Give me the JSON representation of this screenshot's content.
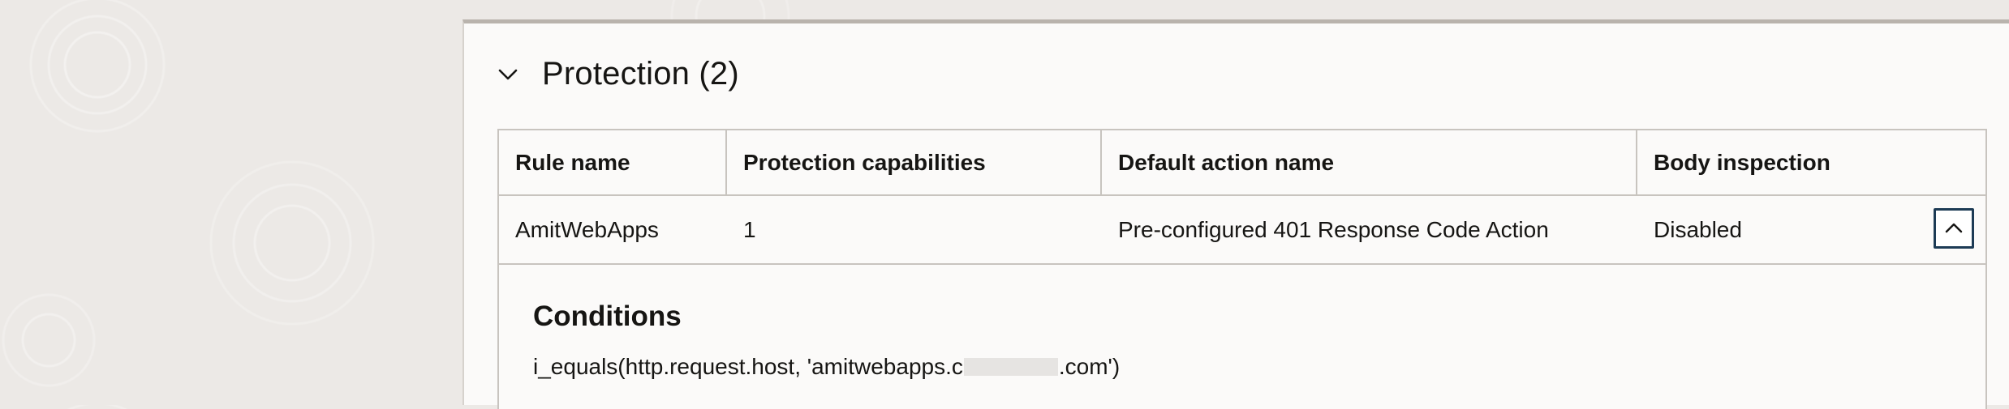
{
  "section": {
    "title": "Protection (2)",
    "expanded": true
  },
  "table": {
    "columns": [
      "Rule name",
      "Protection capabilities",
      "Default action name",
      "Body inspection"
    ],
    "rows": [
      {
        "rule_name": "AmitWebApps",
        "protection_capabilities": "1",
        "default_action_name": "Pre-configured 401 Response Code Action",
        "body_inspection": "Disabled"
      }
    ]
  },
  "detail": {
    "title": "Conditions",
    "condition_prefix": "i_equals(http.request.host, 'amitwebapps.c",
    "condition_suffix": ".com')"
  },
  "colors": {
    "accent": "#1d3b55",
    "border": "#c8c4bf",
    "panel_bg": "#fbfaf9"
  },
  "icons": {
    "section_toggle": "chevron-down-icon",
    "row_toggle": "chevron-up-icon"
  }
}
